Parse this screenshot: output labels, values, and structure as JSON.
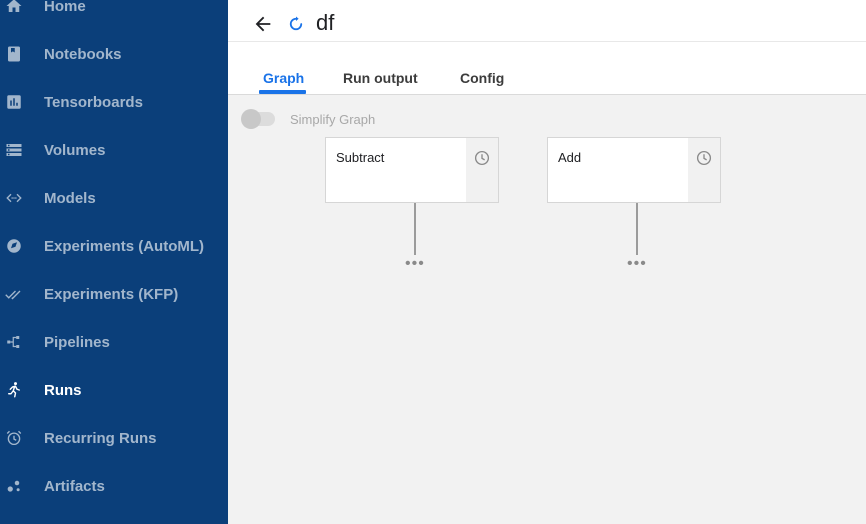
{
  "sidebar": {
    "items": [
      {
        "label": "Home",
        "icon": "home-icon"
      },
      {
        "label": "Notebooks",
        "icon": "notebook-icon"
      },
      {
        "label": "Tensorboards",
        "icon": "tensorboard-icon"
      },
      {
        "label": "Volumes",
        "icon": "volumes-icon"
      },
      {
        "label": "Models",
        "icon": "models-icon"
      },
      {
        "label": "Experiments (AutoML)",
        "icon": "automl-icon"
      },
      {
        "label": "Experiments (KFP)",
        "icon": "double-check-icon"
      },
      {
        "label": "Pipelines",
        "icon": "pipeline-icon"
      },
      {
        "label": "Runs",
        "icon": "run-icon",
        "active": true
      },
      {
        "label": "Recurring Runs",
        "icon": "alarm-icon"
      },
      {
        "label": "Artifacts",
        "icon": "artifacts-icon"
      }
    ]
  },
  "header": {
    "title": "df",
    "status_icon": "running-status-icon"
  },
  "tabs": [
    {
      "label": "Graph",
      "active": true
    },
    {
      "label": "Run output"
    },
    {
      "label": "Config"
    }
  ],
  "graph": {
    "toggle_label": "Simplify Graph",
    "toggle_on": false,
    "nodes": [
      {
        "name": "Subtract",
        "status_icon": "pending-clock-icon"
      },
      {
        "name": "Add",
        "status_icon": "pending-clock-icon"
      }
    ],
    "more_glyph": "•••"
  },
  "colors": {
    "sidebar_bg": "#0b3f7a",
    "accent": "#1a73e8",
    "graph_bg": "#f2f2f2"
  }
}
